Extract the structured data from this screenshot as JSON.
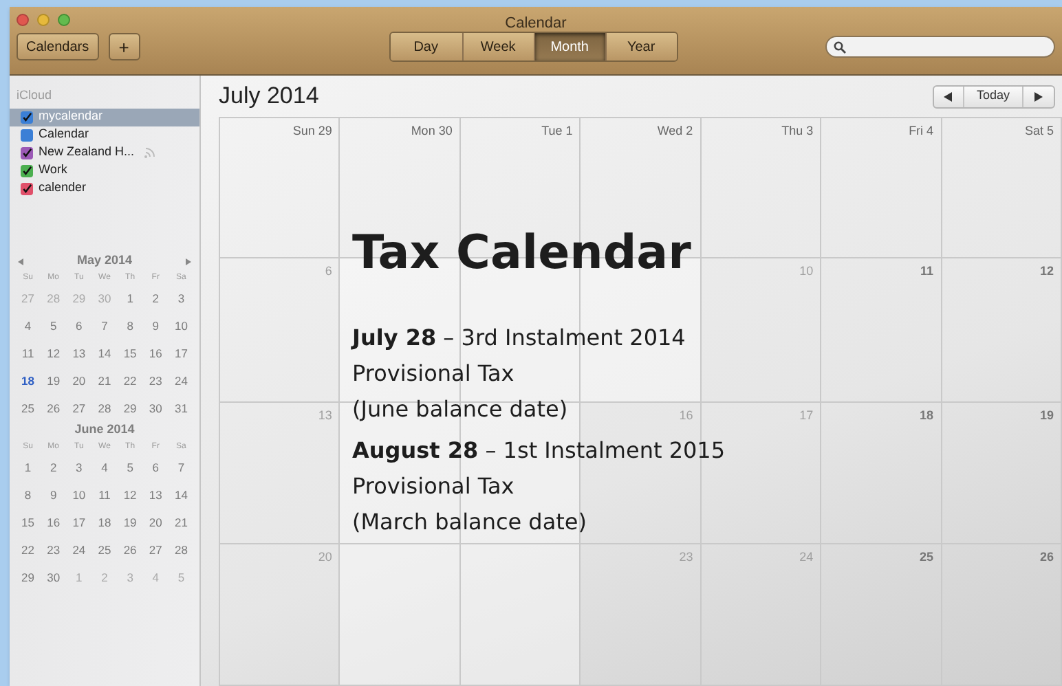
{
  "window": {
    "title": "Calendar"
  },
  "toolbar": {
    "calendars_button": "Calendars",
    "add_button": "+",
    "views": [
      {
        "label": "Day",
        "selected": false
      },
      {
        "label": "Week",
        "selected": false
      },
      {
        "label": "Month",
        "selected": true
      },
      {
        "label": "Year",
        "selected": false
      }
    ]
  },
  "sidebar": {
    "group": "iCloud",
    "calendars": [
      {
        "name": "mycalendar",
        "checked": true,
        "selected": true,
        "color": "#3b7fd6",
        "shared": false
      },
      {
        "name": "Calendar",
        "checked": false,
        "selected": false,
        "color": "#3b7fd6",
        "shared": false
      },
      {
        "name": "New Zealand H...",
        "checked": true,
        "selected": false,
        "color": "#9b59b6",
        "shared": true
      },
      {
        "name": "Work",
        "checked": true,
        "selected": false,
        "color": "#4caf50",
        "shared": false
      },
      {
        "name": "calender",
        "checked": true,
        "selected": false,
        "color": "#e0506a",
        "shared": false
      }
    ]
  },
  "mini_calendars": [
    {
      "title": "May 2014",
      "nav": true,
      "weekdays": [
        "Su",
        "Mo",
        "Tu",
        "We",
        "Th",
        "Fr",
        "Sa"
      ],
      "days": [
        {
          "t": "27",
          "kind": "other"
        },
        {
          "t": "28",
          "kind": "other"
        },
        {
          "t": "29",
          "kind": "other"
        },
        {
          "t": "30",
          "kind": "other"
        },
        {
          "t": "1",
          "kind": "current"
        },
        {
          "t": "2",
          "kind": "current"
        },
        {
          "t": "3",
          "kind": "current"
        },
        {
          "t": "4",
          "kind": "current"
        },
        {
          "t": "5",
          "kind": "current"
        },
        {
          "t": "6",
          "kind": "current"
        },
        {
          "t": "7",
          "kind": "current"
        },
        {
          "t": "8",
          "kind": "current"
        },
        {
          "t": "9",
          "kind": "current"
        },
        {
          "t": "10",
          "kind": "current"
        },
        {
          "t": "11",
          "kind": "current"
        },
        {
          "t": "12",
          "kind": "current"
        },
        {
          "t": "13",
          "kind": "current"
        },
        {
          "t": "14",
          "kind": "current"
        },
        {
          "t": "15",
          "kind": "current"
        },
        {
          "t": "16",
          "kind": "current"
        },
        {
          "t": "17",
          "kind": "current"
        },
        {
          "t": "18",
          "kind": "today"
        },
        {
          "t": "19",
          "kind": "current"
        },
        {
          "t": "20",
          "kind": "current"
        },
        {
          "t": "21",
          "kind": "current"
        },
        {
          "t": "22",
          "kind": "current"
        },
        {
          "t": "23",
          "kind": "current"
        },
        {
          "t": "24",
          "kind": "current"
        },
        {
          "t": "25",
          "kind": "current"
        },
        {
          "t": "26",
          "kind": "current"
        },
        {
          "t": "27",
          "kind": "current"
        },
        {
          "t": "28",
          "kind": "current"
        },
        {
          "t": "29",
          "kind": "current"
        },
        {
          "t": "30",
          "kind": "current"
        },
        {
          "t": "31",
          "kind": "current"
        }
      ]
    },
    {
      "title": "June 2014",
      "nav": false,
      "weekdays": [
        "Su",
        "Mo",
        "Tu",
        "We",
        "Th",
        "Fr",
        "Sa"
      ],
      "days": [
        {
          "t": "1",
          "kind": "current"
        },
        {
          "t": "2",
          "kind": "current"
        },
        {
          "t": "3",
          "kind": "current"
        },
        {
          "t": "4",
          "kind": "current"
        },
        {
          "t": "5",
          "kind": "current"
        },
        {
          "t": "6",
          "kind": "current"
        },
        {
          "t": "7",
          "kind": "current"
        },
        {
          "t": "8",
          "kind": "current"
        },
        {
          "t": "9",
          "kind": "current"
        },
        {
          "t": "10",
          "kind": "current"
        },
        {
          "t": "11",
          "kind": "current"
        },
        {
          "t": "12",
          "kind": "current"
        },
        {
          "t": "13",
          "kind": "current"
        },
        {
          "t": "14",
          "kind": "current"
        },
        {
          "t": "15",
          "kind": "current"
        },
        {
          "t": "16",
          "kind": "current"
        },
        {
          "t": "17",
          "kind": "current"
        },
        {
          "t": "18",
          "kind": "current"
        },
        {
          "t": "19",
          "kind": "current"
        },
        {
          "t": "20",
          "kind": "current"
        },
        {
          "t": "21",
          "kind": "current"
        },
        {
          "t": "22",
          "kind": "current"
        },
        {
          "t": "23",
          "kind": "current"
        },
        {
          "t": "24",
          "kind": "current"
        },
        {
          "t": "25",
          "kind": "current"
        },
        {
          "t": "26",
          "kind": "current"
        },
        {
          "t": "27",
          "kind": "current"
        },
        {
          "t": "28",
          "kind": "current"
        },
        {
          "t": "29",
          "kind": "current"
        },
        {
          "t": "30",
          "kind": "current"
        },
        {
          "t": "1",
          "kind": "other"
        },
        {
          "t": "2",
          "kind": "other"
        },
        {
          "t": "3",
          "kind": "other"
        },
        {
          "t": "4",
          "kind": "other"
        },
        {
          "t": "5",
          "kind": "other"
        }
      ]
    }
  ],
  "month_view": {
    "title": "July 2014",
    "today_button": "Today",
    "weeks": [
      [
        {
          "day": "Sun 29"
        },
        {
          "day": "Mon 30"
        },
        {
          "day": "Tue 1"
        },
        {
          "day": "Wed 2"
        },
        {
          "day": "Thu 3"
        },
        {
          "day": "Fri 4"
        },
        {
          "day": "Sat 5"
        }
      ],
      [
        {
          "day": "6"
        },
        {
          "kind": "covered"
        },
        {
          "kind": "covered"
        },
        {
          "kind": "covered"
        },
        {
          "day": "10"
        },
        {
          "day": "11"
        },
        {
          "day": "12"
        }
      ],
      [
        {
          "day": "13"
        },
        {
          "kind": "covered"
        },
        {
          "kind": "covered"
        },
        {
          "day": "16"
        },
        {
          "day": "17"
        },
        {
          "day": "18"
        },
        {
          "day": "19"
        }
      ],
      [
        {
          "day": "20"
        },
        {
          "kind": "covered"
        },
        {
          "kind": "covered"
        },
        {
          "day": "23"
        },
        {
          "day": "24"
        },
        {
          "day": "25"
        },
        {
          "day": "26"
        }
      ]
    ]
  },
  "overlay": {
    "title": "Tax Calendar",
    "entries": [
      {
        "lines": [
          "**July 28** – 3rd Instalment 2014",
          "Provisional Tax",
          "(June balance date)"
        ]
      },
      {
        "lines": [
          "**August 28** – 1st Instalment 2015",
          "Provisional Tax",
          "(March balance date)"
        ]
      }
    ]
  }
}
